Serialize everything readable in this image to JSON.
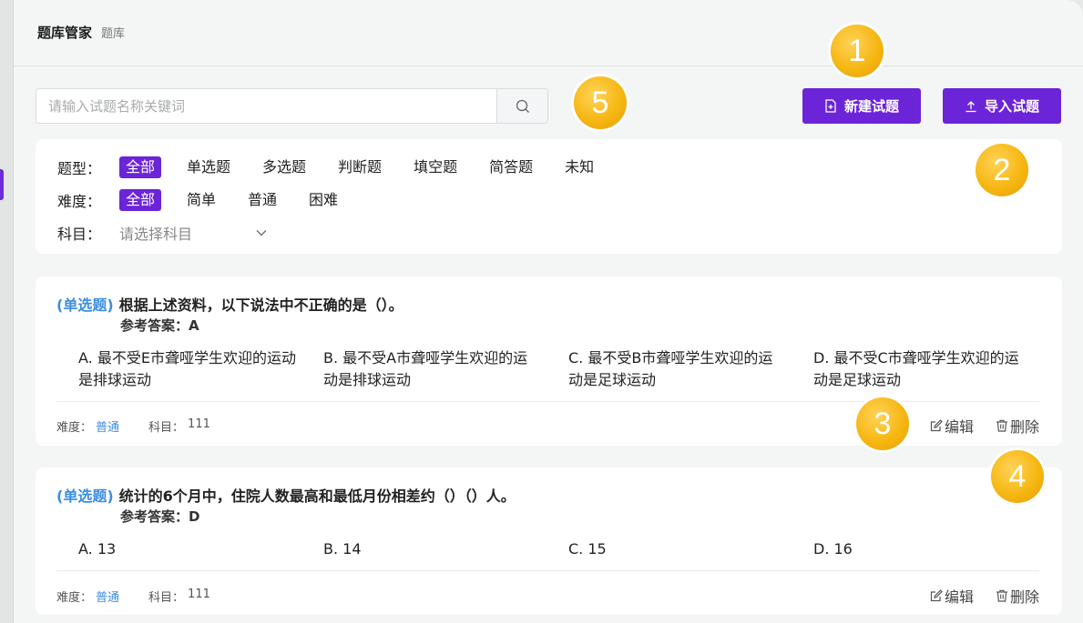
{
  "header": {
    "title": "题库管家",
    "breadcrumb": "题库"
  },
  "search": {
    "placeholder": "请输入试题名称关键词",
    "value": ""
  },
  "toolbar": {
    "new_label": "新建试题",
    "import_label": "导入试题"
  },
  "filters": {
    "type": {
      "label": "题型：",
      "options": [
        "全部",
        "单选题",
        "多选题",
        "判断题",
        "填空题",
        "简答题",
        "未知"
      ],
      "selected": "全部"
    },
    "difficulty": {
      "label": "难度：",
      "options": [
        "全部",
        "简单",
        "普通",
        "困难"
      ],
      "selected": "全部"
    },
    "subject": {
      "label": "科目：",
      "placeholder": "请选择科目"
    }
  },
  "questions": [
    {
      "type": "(单选题)",
      "text": "根据上述资料，以下说法中不正确的是（）。",
      "answer": "参考答案：A",
      "options": [
        "A. 最不受E市聋哑学生欢迎的运动是排球运动",
        "B. 最不受A市聋哑学生欢迎的运动是排球运动",
        "C. 最不受B市聋哑学生欢迎的运动是足球运动",
        "D. 最不受C市聋哑学生欢迎的运动是足球运动"
      ],
      "difficulty_label": "难度：",
      "difficulty": "普通",
      "subject_label": "科目：",
      "subject": "111",
      "edit_label": "编辑",
      "delete_label": "删除"
    },
    {
      "type": "(单选题)",
      "text": "统计的6个月中，住院人数最高和最低月份相差约（）（）人。",
      "answer": "参考答案：D",
      "options": [
        "A. 13",
        "B. 14",
        "C. 15",
        "D. 16"
      ],
      "difficulty_label": "难度：",
      "difficulty": "普通",
      "subject_label": "科目：",
      "subject": "111",
      "edit_label": "编辑",
      "delete_label": "删除"
    }
  ],
  "callouts": [
    "1",
    "2",
    "3",
    "4",
    "5"
  ],
  "colors": {
    "accent": "#6c24d8",
    "link": "#3b8de0",
    "callout": "#f6b712"
  },
  "icons": [
    "search-icon",
    "file-plus-icon",
    "upload-icon",
    "chevron-down-icon",
    "edit-icon",
    "trash-icon"
  ]
}
